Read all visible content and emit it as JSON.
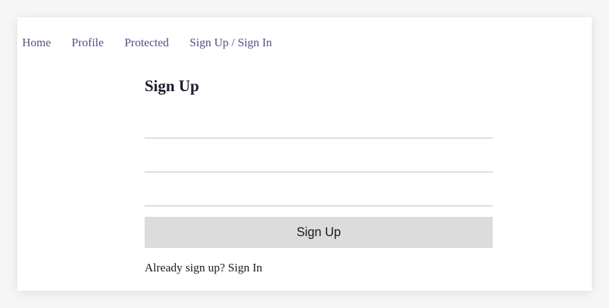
{
  "nav": {
    "items": [
      {
        "label": "Home"
      },
      {
        "label": "Profile"
      },
      {
        "label": "Protected"
      },
      {
        "label": "Sign Up / Sign In"
      }
    ]
  },
  "form": {
    "title": "Sign Up",
    "fields": [
      {
        "value": "",
        "placeholder": ""
      },
      {
        "value": "",
        "placeholder": ""
      },
      {
        "value": "",
        "placeholder": ""
      }
    ],
    "submit_label": "Sign Up"
  },
  "footer": {
    "prompt": "Already sign up?",
    "link_label": "Sign In"
  },
  "colors": {
    "nav_link": "#5b4a85",
    "button_bg": "#dcdcdc",
    "field_underline": "#dcdcdc"
  }
}
